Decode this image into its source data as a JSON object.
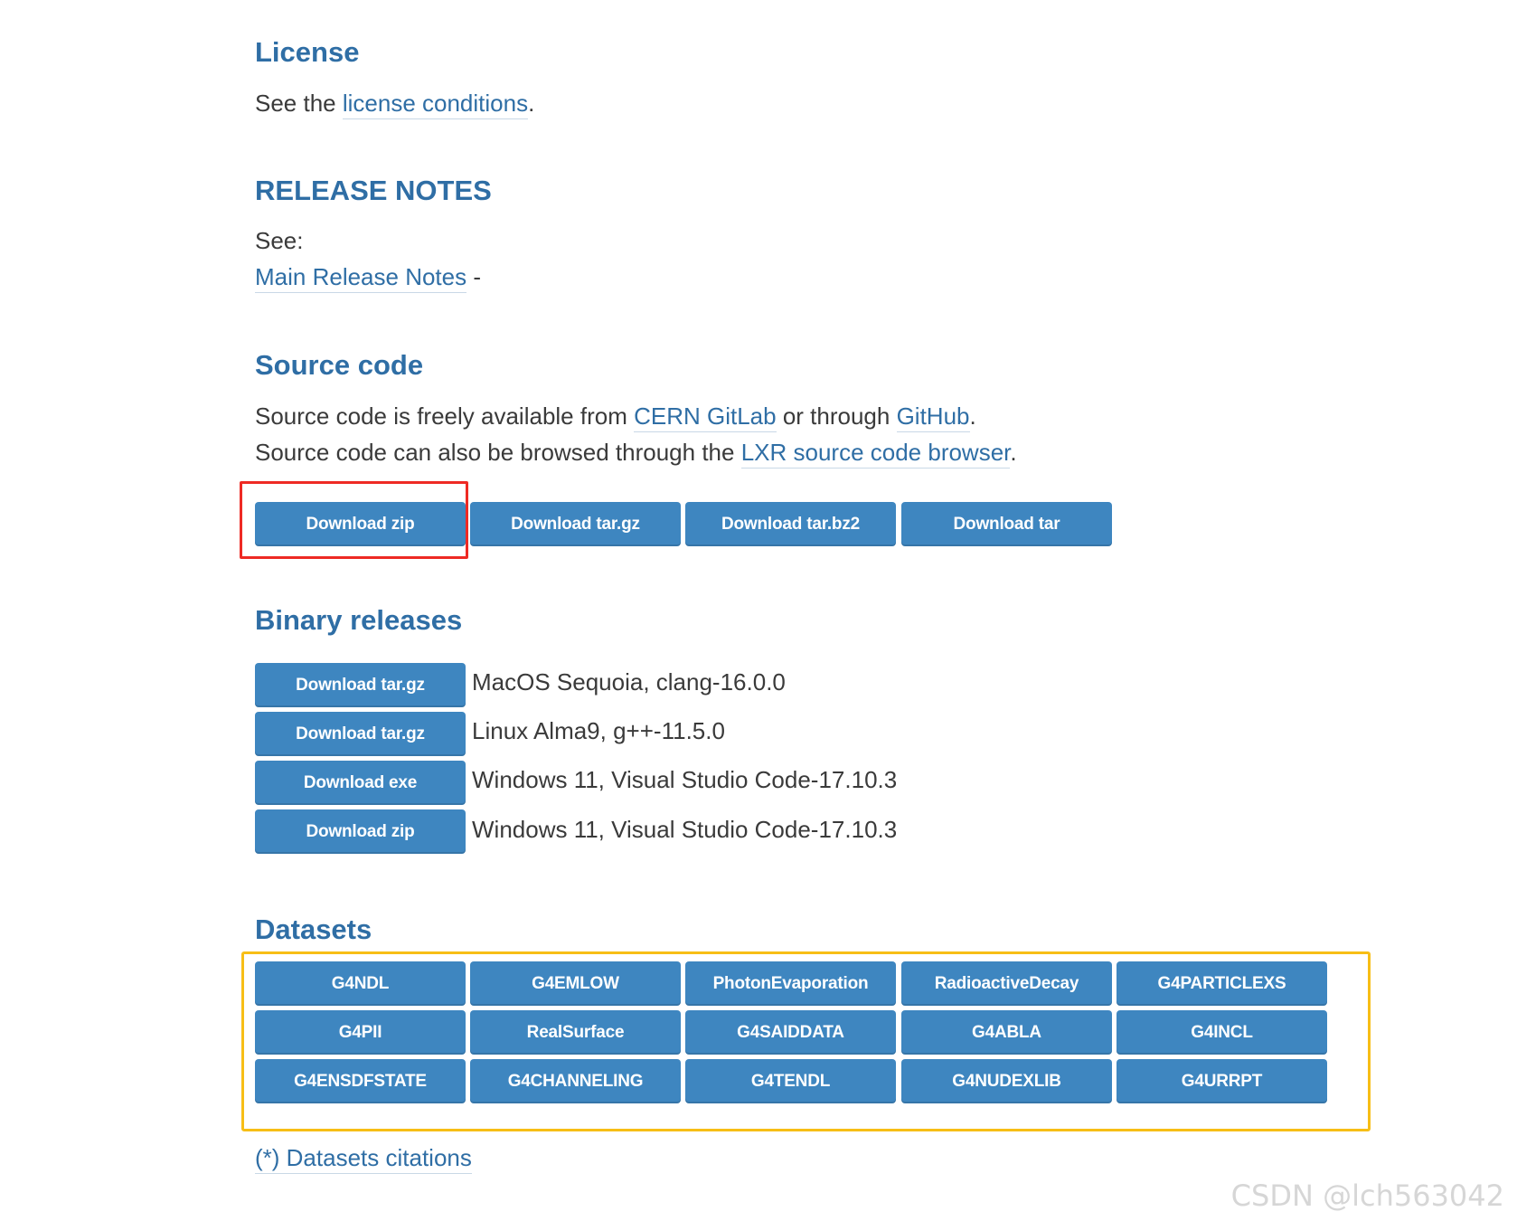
{
  "license": {
    "heading": "License",
    "text_before": "See the ",
    "link": "license conditions",
    "text_after": "."
  },
  "release_notes": {
    "heading": "RELEASE NOTES",
    "see": "See:",
    "link": "Main Release Notes",
    "suffix": " -"
  },
  "source_code": {
    "heading": "Source code",
    "line1_before": "Source code is freely available from ",
    "line1_link1": "CERN GitLab",
    "line1_middle": " or through ",
    "line1_link2": "GitHub",
    "line1_after": ".",
    "line2_before": "Source code can also be browsed through the ",
    "line2_link": "LXR source code browser",
    "line2_after": ".",
    "buttons": [
      "Download zip",
      "Download tar.gz",
      "Download tar.bz2",
      "Download tar"
    ]
  },
  "binary_releases": {
    "heading": "Binary releases",
    "rows": [
      {
        "button": "Download tar.gz",
        "desc": "MacOS Sequoia, clang-16.0.0"
      },
      {
        "button": "Download tar.gz",
        "desc": "Linux Alma9, g++-11.5.0"
      },
      {
        "button": "Download exe",
        "desc": "Windows 11, Visual Studio Code-17.10.3"
      },
      {
        "button": "Download zip",
        "desc": "Windows 11, Visual Studio Code-17.10.3"
      }
    ]
  },
  "datasets": {
    "heading": "Datasets",
    "buttons": [
      "G4NDL",
      "G4EMLOW",
      "PhotonEvaporation",
      "RadioactiveDecay",
      "G4PARTICLEXS",
      "G4PII",
      "RealSurface",
      "G4SAIDDATA",
      "G4ABLA",
      "G4INCL",
      "G4ENSDFSTATE",
      "G4CHANNELING",
      "G4TENDL",
      "G4NUDEXLIB",
      "G4URRPT"
    ],
    "citations_link": "(*) Datasets citations"
  },
  "highlights": {
    "red_color": "#ee2a24",
    "yellow_color": "#f7be16"
  },
  "colors": {
    "heading": "#2f6ea5",
    "link": "#2f6ea5",
    "button_bg": "#3e86c0",
    "button_text": "#ffffff"
  },
  "watermark": "CSDN @lch563042"
}
